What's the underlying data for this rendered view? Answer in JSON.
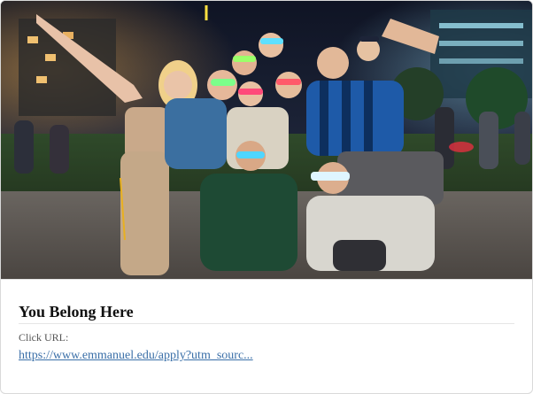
{
  "card": {
    "image_description_icon": "photo-students-celebrating",
    "title": "You Belong Here",
    "click_url_label": "Click URL:",
    "click_url": "https://www.emmanuel.edu/apply?utm_sourc..."
  },
  "colors": {
    "title": "#111111",
    "label": "#555555",
    "link": "#3a6fa8",
    "border": "#d9d9d9"
  }
}
